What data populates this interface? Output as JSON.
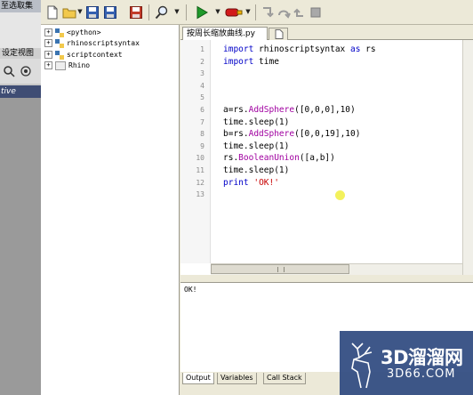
{
  "left_panel": {
    "title": "至选取集",
    "view_label": "设定视图",
    "viewport_label": "tive"
  },
  "tree": {
    "items": [
      {
        "label": "<python>"
      },
      {
        "label": "rhinoscriptsyntax"
      },
      {
        "label": "scriptcontext"
      },
      {
        "label": "Rhino"
      }
    ]
  },
  "tabs": [
    {
      "label": "按周长缩放曲线.py"
    }
  ],
  "code": {
    "lines": [
      {
        "n": "1",
        "segs": [
          {
            "t": "import",
            "c": "kw"
          },
          {
            "t": " rhinoscriptsyntax ",
            "c": ""
          },
          {
            "t": "as",
            "c": "kw"
          },
          {
            "t": " rs",
            "c": ""
          }
        ]
      },
      {
        "n": "2",
        "segs": [
          {
            "t": "import",
            "c": "kw"
          },
          {
            "t": " time",
            "c": ""
          }
        ]
      },
      {
        "n": "3",
        "segs": []
      },
      {
        "n": "4",
        "segs": []
      },
      {
        "n": "5",
        "segs": []
      },
      {
        "n": "6",
        "segs": [
          {
            "t": "a=rs.",
            "c": ""
          },
          {
            "t": "AddSphere",
            "c": "fn"
          },
          {
            "t": "([0,0,0],10)",
            "c": ""
          }
        ]
      },
      {
        "n": "7",
        "segs": [
          {
            "t": "time.sleep(1)",
            "c": ""
          }
        ]
      },
      {
        "n": "8",
        "segs": [
          {
            "t": "b=rs.",
            "c": ""
          },
          {
            "t": "AddSphere",
            "c": "fn"
          },
          {
            "t": "([0,0,19],10)",
            "c": ""
          }
        ]
      },
      {
        "n": "9",
        "segs": [
          {
            "t": "time.sleep(1)",
            "c": ""
          }
        ]
      },
      {
        "n": "10",
        "segs": [
          {
            "t": "rs.",
            "c": ""
          },
          {
            "t": "BooleanUnion",
            "c": "fn"
          },
          {
            "t": "([a,b])",
            "c": ""
          }
        ]
      },
      {
        "n": "11",
        "segs": [
          {
            "t": "time.sleep(1)",
            "c": ""
          }
        ]
      },
      {
        "n": "12",
        "segs": [
          {
            "t": "print",
            "c": "kw"
          },
          {
            "t": " ",
            "c": ""
          },
          {
            "t": "'OK!'",
            "c": "str"
          }
        ]
      },
      {
        "n": "13",
        "segs": []
      }
    ]
  },
  "output": {
    "text": "OK!",
    "tabs": [
      "Output",
      "Variables",
      "Call Stack"
    ],
    "active_tab": 0
  },
  "watermark": {
    "title": "3D溜溜网",
    "url": "3D66.COM"
  },
  "colors": {
    "keyword": "#0000c8",
    "function": "#a000a0",
    "string": "#c80000",
    "run_green": "#1f9a2a",
    "stop_red": "#d21a1a",
    "watermark_bg": "#2f4a80"
  },
  "icons": [
    "new-file-icon",
    "open-folder-icon",
    "save-icon",
    "save-all-icon",
    "save-as-icon",
    "find-icon",
    "run-icon",
    "debug-icon",
    "step-into-icon",
    "step-over-icon",
    "step-out-icon",
    "stop-icon"
  ]
}
